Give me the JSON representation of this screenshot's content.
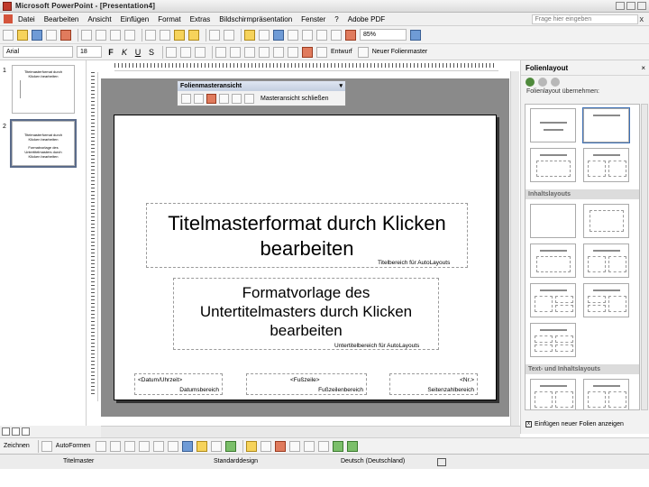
{
  "window": {
    "title": "Microsoft PowerPoint - [Presentation4]"
  },
  "menu": {
    "items": [
      "Datei",
      "Bearbeiten",
      "Ansicht",
      "Einfügen",
      "Format",
      "Extras",
      "Bildschirmpräsentation",
      "Fenster",
      "?",
      "Adobe PDF"
    ],
    "help_placeholder": "Frage hier eingeben",
    "close_symbol": "x"
  },
  "toolbar1": {
    "zoom": "85%"
  },
  "toolbar2": {
    "font": "Arial",
    "size": "18",
    "bold": "F",
    "italic": "K",
    "underline": "U",
    "shadow": "S",
    "design": "Entwurf",
    "new_slide": "Neuer Folienmaster"
  },
  "slides_panel": {
    "thumb1": {
      "number": "1",
      "title": "Titelmasterformat durch Klicken bearbeiten"
    },
    "thumb2": {
      "number": "2",
      "title": "Titelmasterformat durch Klicken bearbeiten",
      "subtitle": "Formatvorlage des Untertitelmasters durch Klicken bearbeiten"
    }
  },
  "master_toolbar": {
    "title": "Folienmasteransicht",
    "close_label": "Masteransicht schließen"
  },
  "slide": {
    "title": "Titelmasterformat durch Klicken bearbeiten",
    "title_area_label": "Titelbereich für AutoLayouts",
    "subtitle": "Formatvorlage des Untertitelmasters durch Klicken bearbeiten",
    "subtitle_area_label": "Untertitelbereich für AutoLayouts",
    "date_placeholder": "<Datum/Uhrzeit>",
    "date_label": "Datumsbereich",
    "footer_placeholder": "<Fußzeile>",
    "footer_label": "Fußzeilenbereich",
    "number_placeholder": "<Nr.>",
    "number_label": "Seitenzahlbereich"
  },
  "taskpane": {
    "title": "Folienlayout",
    "apply_label": "Folienlayout übernehmen:",
    "section_content": "Inhaltslayouts",
    "section_text_content": "Text- und Inhaltslayouts",
    "checkbox_label": "Einfügen neuer Folien anzeigen",
    "checkbox_mark": "x"
  },
  "drawbar": {
    "draw_label": "Zeichnen",
    "autoshapes_label": "AutoFormen"
  },
  "status": {
    "view": "Titelmaster",
    "design": "Standarddesign",
    "language": "Deutsch (Deutschland)"
  }
}
